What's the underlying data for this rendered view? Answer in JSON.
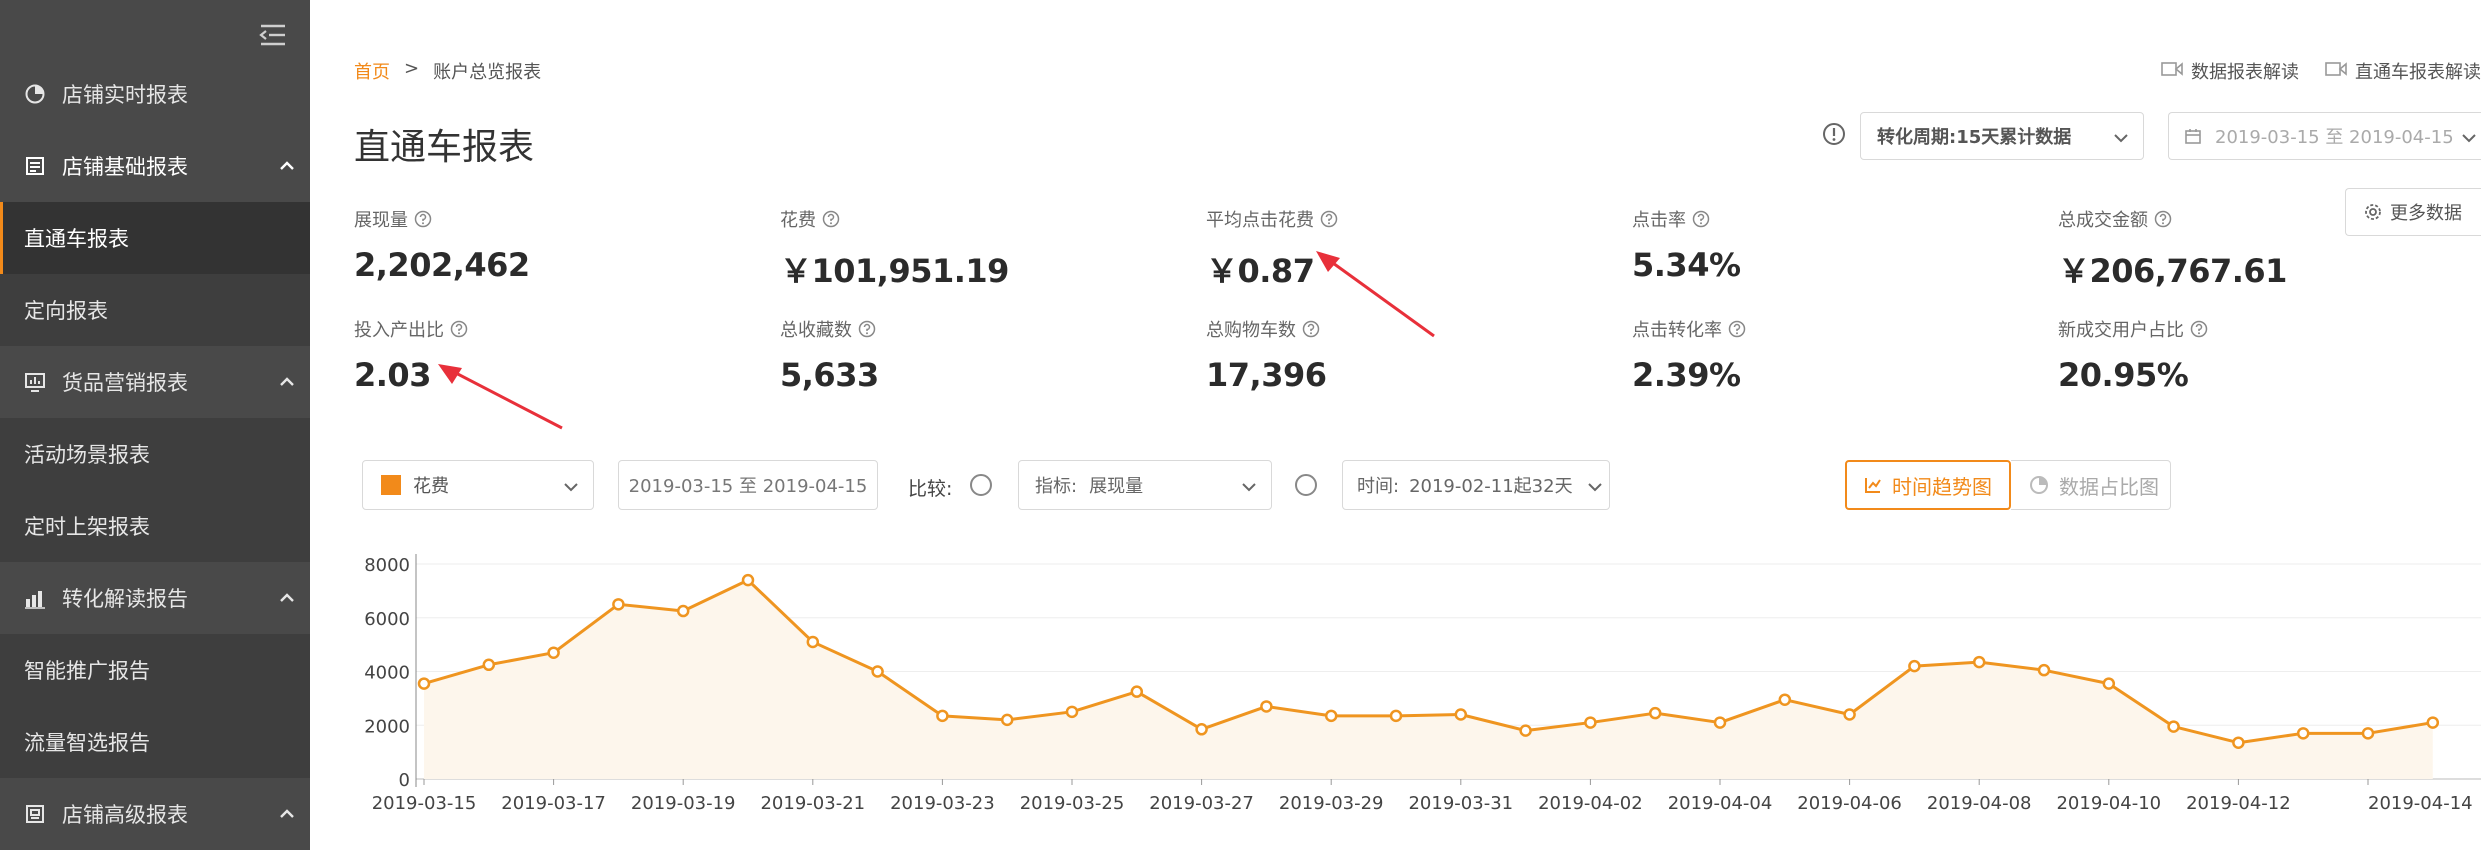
{
  "sidebar": {
    "items": [
      {
        "label": "店铺实时报表",
        "icon": "pie-clock-icon"
      },
      {
        "label": "店铺基础报表",
        "icon": "report-icon"
      },
      {
        "label": "直通车报表"
      },
      {
        "label": "定向报表"
      },
      {
        "label": "货品营销报表",
        "icon": "monitor-chart-icon"
      },
      {
        "label": "活动场景报表"
      },
      {
        "label": "定时上架报表"
      },
      {
        "label": "转化解读报告",
        "icon": "bar-chart-icon"
      },
      {
        "label": "智能推广报告"
      },
      {
        "label": "流量智选报告"
      },
      {
        "label": "店铺高级报表",
        "icon": "report-box-icon"
      }
    ]
  },
  "breadcrumb": {
    "home": "首页",
    "sep": ">",
    "current": "账户总览报表"
  },
  "top_links": {
    "link1": "数据报表解读",
    "link2": "直通车报表解读"
  },
  "title": "直通车报表",
  "filters": {
    "period": "转化周期:15天累计数据",
    "date_range": "2019-03-15  至  2019-04-15",
    "more": "更多数据"
  },
  "metrics": [
    {
      "label": "展现量",
      "value": "2,202,462"
    },
    {
      "label": "花费",
      "value": "￥101,951.19"
    },
    {
      "label": "平均点击花费",
      "value": "￥0.87"
    },
    {
      "label": "点击率",
      "value": "5.34%"
    },
    {
      "label": "总成交金额",
      "value": "￥206,767.61"
    },
    {
      "label": "投入产出比",
      "value": "2.03"
    },
    {
      "label": "总收藏数",
      "value": "5,633"
    },
    {
      "label": "总购物车数",
      "value": "17,396"
    },
    {
      "label": "点击转化率",
      "value": "2.39%"
    },
    {
      "label": "新成交用户占比",
      "value": "20.95%"
    }
  ],
  "controls": {
    "metric_select": "花费",
    "date_range": "2019-03-15 至 2019-04-15",
    "compare_label": "比较:",
    "indicator_label": "指标:",
    "indicator_value": "展现量",
    "time_label": "时间:",
    "time_value": "2019-02-11起32天",
    "trend_button": "时间趋势图",
    "pie_button": "数据占比图"
  },
  "colors": {
    "accent": "#f28a1a",
    "line": "#ef9520",
    "sidebar": "#494949",
    "arrow": "#e8303a"
  },
  "chart_data": {
    "type": "line",
    "series": [
      {
        "values": [
          3550,
          4250,
          4700,
          6500,
          6250,
          7400,
          5100,
          4000,
          2350,
          2200,
          2500,
          3250,
          1850,
          2700,
          2350,
          2350,
          2400,
          1800,
          2100,
          2450,
          2100,
          2950,
          2400,
          4200,
          4350,
          4050,
          3550,
          1950,
          1350,
          1700,
          1700,
          2100
        ]
      }
    ],
    "x": [
      "2019-03-15",
      "2019-03-16",
      "2019-03-17",
      "2019-03-18",
      "2019-03-19",
      "2019-03-20",
      "2019-03-21",
      "2019-03-22",
      "2019-03-23",
      "2019-03-24",
      "2019-03-25",
      "2019-03-26",
      "2019-03-27",
      "2019-03-28",
      "2019-03-29",
      "2019-03-30",
      "2019-03-31",
      "2019-04-01",
      "2019-04-02",
      "2019-04-03",
      "2019-04-04",
      "2019-04-05",
      "2019-04-06",
      "2019-04-07",
      "2019-04-08",
      "2019-04-09",
      "2019-04-10",
      "2019-04-11",
      "2019-04-12",
      "2019-04-13",
      "2019-04-14",
      "2019-04-15"
    ],
    "xticks": [
      "2019-03-15",
      "2019-03-17",
      "2019-03-19",
      "2019-03-21",
      "2019-03-23",
      "2019-03-25",
      "2019-03-27",
      "2019-03-29",
      "2019-03-31",
      "2019-04-02",
      "2019-04-04",
      "2019-04-06",
      "2019-04-08",
      "2019-04-10",
      "2019-04-12",
      "2019-04-14"
    ],
    "yticks": [
      0,
      2000,
      4000,
      6000,
      8000
    ],
    "ylim": [
      0,
      8000
    ],
    "grid": true
  }
}
